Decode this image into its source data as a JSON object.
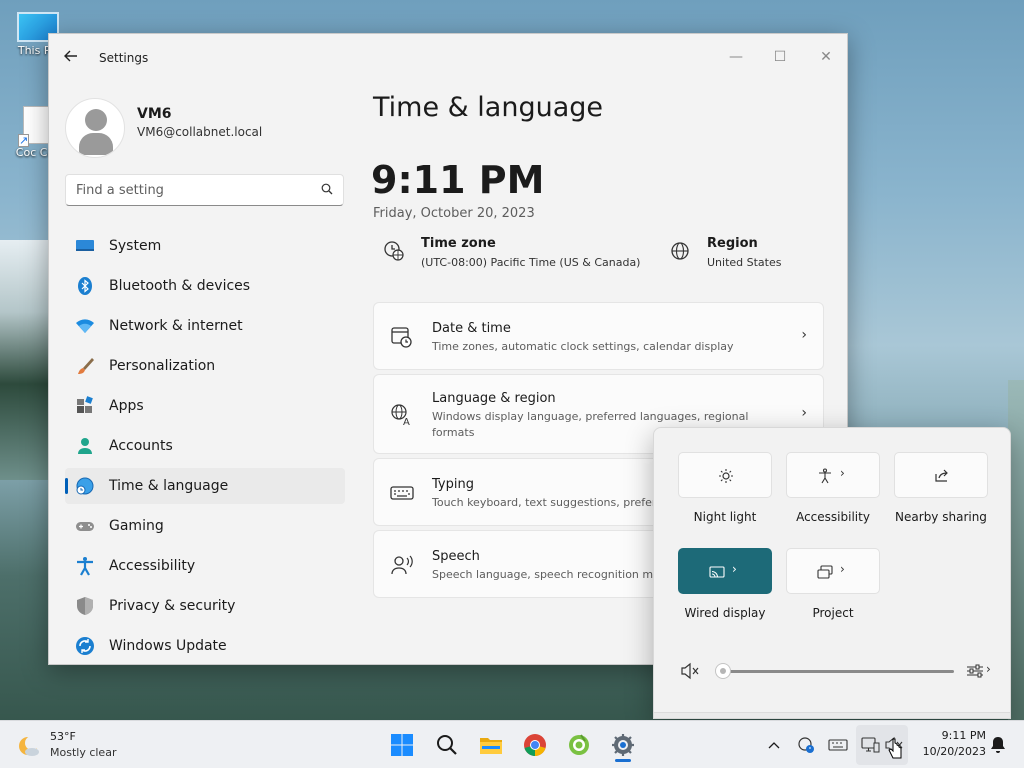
{
  "desktop": {
    "icons": [
      {
        "label": "This PC"
      },
      {
        "label": "Coc Coc"
      }
    ]
  },
  "window": {
    "title": "Settings",
    "controls": {
      "minimize": "—",
      "maximize": "☐",
      "close": "✕"
    }
  },
  "profile": {
    "name": "VM6",
    "email": "VM6@collabnet.local"
  },
  "search": {
    "placeholder": "Find a setting"
  },
  "nav": {
    "items": [
      {
        "label": "System",
        "icon": "monitor-icon"
      },
      {
        "label": "Bluetooth & devices",
        "icon": "bluetooth-icon"
      },
      {
        "label": "Network & internet",
        "icon": "wifi-icon"
      },
      {
        "label": "Personalization",
        "icon": "brush-icon"
      },
      {
        "label": "Apps",
        "icon": "apps-icon"
      },
      {
        "label": "Accounts",
        "icon": "person-icon"
      },
      {
        "label": "Time & language",
        "icon": "globe-clock-icon",
        "selected": true
      },
      {
        "label": "Gaming",
        "icon": "gamepad-icon"
      },
      {
        "label": "Accessibility",
        "icon": "accessibility-icon"
      },
      {
        "label": "Privacy & security",
        "icon": "shield-icon"
      },
      {
        "label": "Windows Update",
        "icon": "update-icon"
      }
    ]
  },
  "main": {
    "title": "Time & language",
    "time": "9:11 PM",
    "date": "Friday, October 20, 2023",
    "timezone": {
      "title": "Time zone",
      "value": "(UTC-08:00) Pacific Time (US & Canada)"
    },
    "region": {
      "title": "Region",
      "value": "United States"
    },
    "cards": [
      {
        "title": "Date & time",
        "desc": "Time zones, automatic clock settings, calendar display",
        "icon": "calendar-clock-icon"
      },
      {
        "title": "Language & region",
        "desc": "Windows display language, preferred languages, regional formats",
        "icon": "language-icon"
      },
      {
        "title": "Typing",
        "desc": "Touch keyboard, text suggestions, prefere",
        "icon": "keyboard-icon"
      },
      {
        "title": "Speech",
        "desc": "Speech language, speech recognition mic",
        "icon": "speech-icon"
      }
    ]
  },
  "quick_settings": {
    "tiles": [
      {
        "label": "Night light",
        "icon": "brightness-icon",
        "active": false
      },
      {
        "label": "Accessibility",
        "icon": "accessibility-icon",
        "active": false,
        "has_chevron": true
      },
      {
        "label": "Nearby sharing",
        "icon": "share-icon",
        "active": false
      },
      {
        "label": "Wired display",
        "icon": "cast-icon",
        "active": true,
        "has_chevron": true
      },
      {
        "label": "Project",
        "icon": "project-icon",
        "active": false,
        "has_chevron": true
      }
    ],
    "volume": {
      "level": 0,
      "muted": true
    }
  },
  "taskbar": {
    "weather": {
      "temp": "53°F",
      "desc": "Mostly clear"
    },
    "apps": [
      "start",
      "search",
      "file-explorer",
      "chrome",
      "coc-coc",
      "settings"
    ],
    "clock": {
      "time": "9:11 PM",
      "date": "10/20/2023"
    }
  },
  "colors": {
    "accent": "#005fb8",
    "active_tile": "#1d6a78"
  }
}
